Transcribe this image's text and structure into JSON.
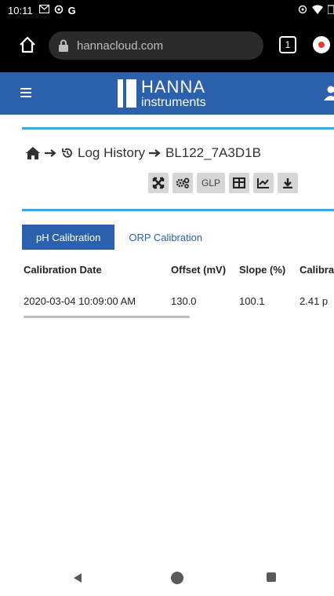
{
  "status_bar": {
    "time": "10:11",
    "left_icons": [
      "mail-icon",
      "settings-icon",
      "google-icon"
    ],
    "right_icons": [
      "vpn-icon",
      "wifi-icon",
      "battery-icon"
    ]
  },
  "browser": {
    "url": "hannacloud.com",
    "tab_count": "1"
  },
  "header": {
    "brand": "HANNA",
    "brand_sub": "instruments",
    "bg_color": "#2b60ad"
  },
  "breadcrumb": {
    "items": [
      "Log History",
      "BL122_7A3D1B"
    ]
  },
  "toolbar": {
    "buttons": [
      "expand-icon",
      "settings-gears-icon",
      "GLP",
      "table-icon",
      "chart-icon",
      "download-icon"
    ],
    "glp_label": "GLP"
  },
  "tabs": [
    {
      "label": "pH Calibration",
      "active": true
    },
    {
      "label": "ORP Calibration",
      "active": false
    }
  ],
  "table": {
    "headers": [
      "Calibration Date",
      "Offset (mV)",
      "Slope (%)",
      "Calibra"
    ],
    "rows": [
      [
        "2020-03-04 10:09:00 AM",
        "130.0",
        "100.1",
        "2.41 p"
      ]
    ]
  },
  "colors": {
    "accent": "#2b60ad",
    "rule": "#35aee0"
  }
}
